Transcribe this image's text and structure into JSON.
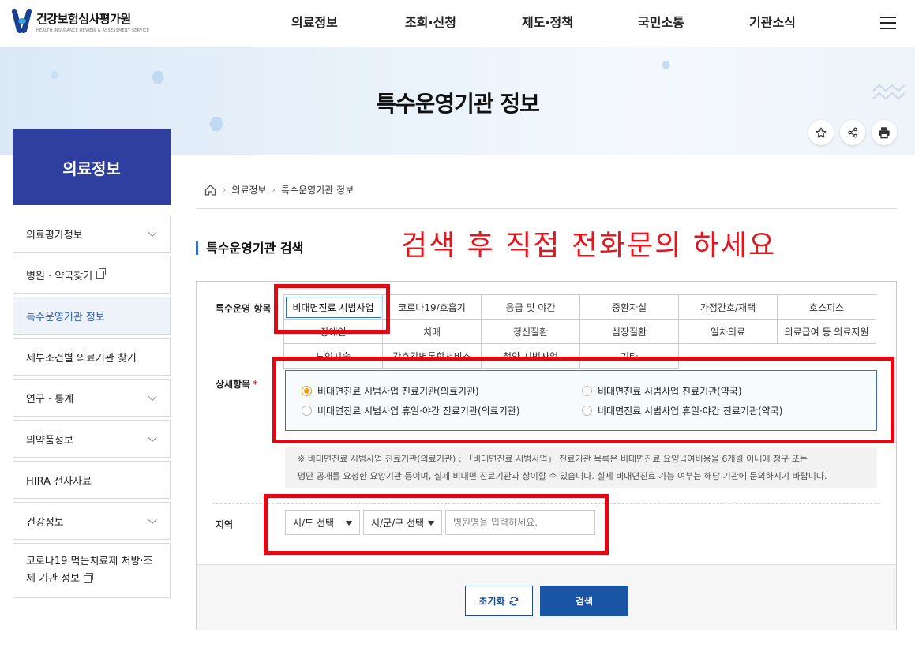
{
  "header": {
    "logo_ko": "건강보험심사평가원",
    "logo_en": "HEALTH INSURANCE REVIEW & ASSESSMENT SERVICE",
    "nav": [
      "의료정보",
      "조회·신청",
      "제도·정책",
      "국민소통",
      "기관소식"
    ]
  },
  "banner": {
    "title": "특수운영기관 정보"
  },
  "lnb": {
    "title": "의료정보",
    "items": [
      {
        "label": "의료평가정보"
      },
      {
        "label": "병원 · 약국찾기"
      },
      {
        "label": "특수운영기관 정보"
      },
      {
        "label": "세부조건별 의료기관 찾기"
      },
      {
        "label": "연구 · 통계"
      },
      {
        "label": "의약품정보"
      },
      {
        "label": "HIRA 전자자료"
      },
      {
        "label": "건강정보"
      },
      {
        "label": "코로나19 먹는치료제 처방·조제 기관 정보"
      }
    ]
  },
  "breadcrumb": [
    "의료정보",
    "특수운영기관 정보"
  ],
  "section": {
    "title": "특수운영기관 검색"
  },
  "annotation": "검색 후 직접 전화문의 하세요",
  "form": {
    "category_label": "특수운영 항목",
    "detail_label": "상세항목",
    "required_mark": "*",
    "region_label": "지역",
    "categories": [
      "비대면진료 시범사업",
      "코로나19/호흡기",
      "응급 및 야간",
      "중환자실",
      "가정간호/재택",
      "호스피스",
      "장애인",
      "치매",
      "정신질환",
      "심장질환",
      "일차의료",
      "의료급여 등 의료지원",
      "노인시술",
      "간호간병통합서비스",
      "첩약 시범사업",
      "기타"
    ],
    "detail_options": [
      "비대면진료 시범사업 진료기관(의료기관)",
      "비대면진료 시범사업 진료기관(약국)",
      "비대면진료 시범사업 휴일·야간 진료기관(의료기관)",
      "비대면진료 시범사업 휴일·야간 진료기관(약국)"
    ],
    "note_line1": "※ 비대면진료 시범사업 진료기관(의료기관) : 「비대면진료 시범사업」 진료기관 목록은 비대면진료 요양급여비용을 6개월 이내에 청구 또는",
    "note_line2": "명단 공개를 요청한 요양기관 등이며, 실제 비대면 진료기관과 상이할 수 있습니다. 실제 비대면진료 가능 여부는 해당 기관에 문의하시기 바랍니다.",
    "sido_select": "시/도 선택",
    "sigungu_select": "시/군/구 선택",
    "hospital_placeholder": "병원명을 입력하세요.",
    "reset_label": "초기화",
    "search_label": "검색"
  }
}
